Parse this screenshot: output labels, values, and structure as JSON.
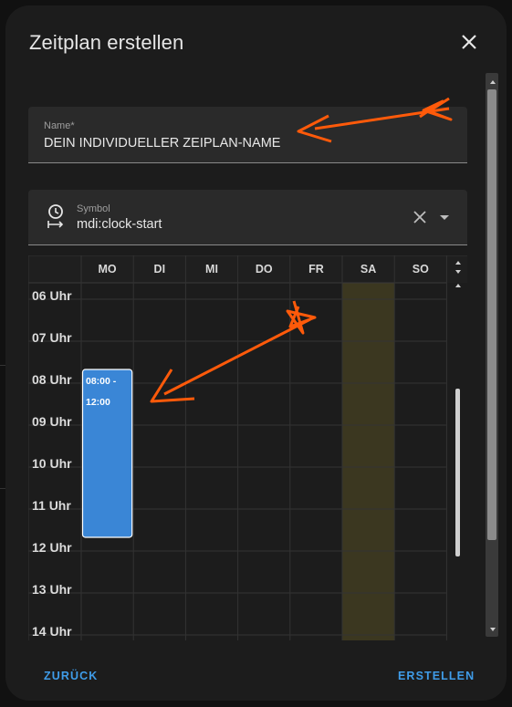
{
  "dialog": {
    "title": "Zeitplan erstellen"
  },
  "name_field": {
    "label": "Name*",
    "value": "DEIN INDIVIDUELLER ZEIPLAN-NAME"
  },
  "icon_field": {
    "label": "Symbol",
    "value": "mdi:clock-start",
    "icon": "clock-start-icon"
  },
  "schedule": {
    "days": [
      "MO",
      "DI",
      "MI",
      "DO",
      "FR",
      "SA",
      "SO"
    ],
    "hours": [
      "06 Uhr",
      "07 Uhr",
      "08 Uhr",
      "09 Uhr",
      "10 Uhr",
      "11 Uhr",
      "12 Uhr",
      "13 Uhr",
      "14 Uhr"
    ],
    "highlight_day": "SA",
    "block": {
      "day": "MO",
      "start": "08:00",
      "end": "12:00",
      "text_line1": "08:00 -",
      "text_line2": "12:00"
    }
  },
  "buttons": {
    "back": "ZURÜCK",
    "create": "ERSTELLEN"
  },
  "colors": {
    "accent": "#3f9ce8",
    "block": "#3a86d6",
    "annotation_arrow": "#ff5a0a",
    "weekend_highlight": "#3b3720"
  }
}
